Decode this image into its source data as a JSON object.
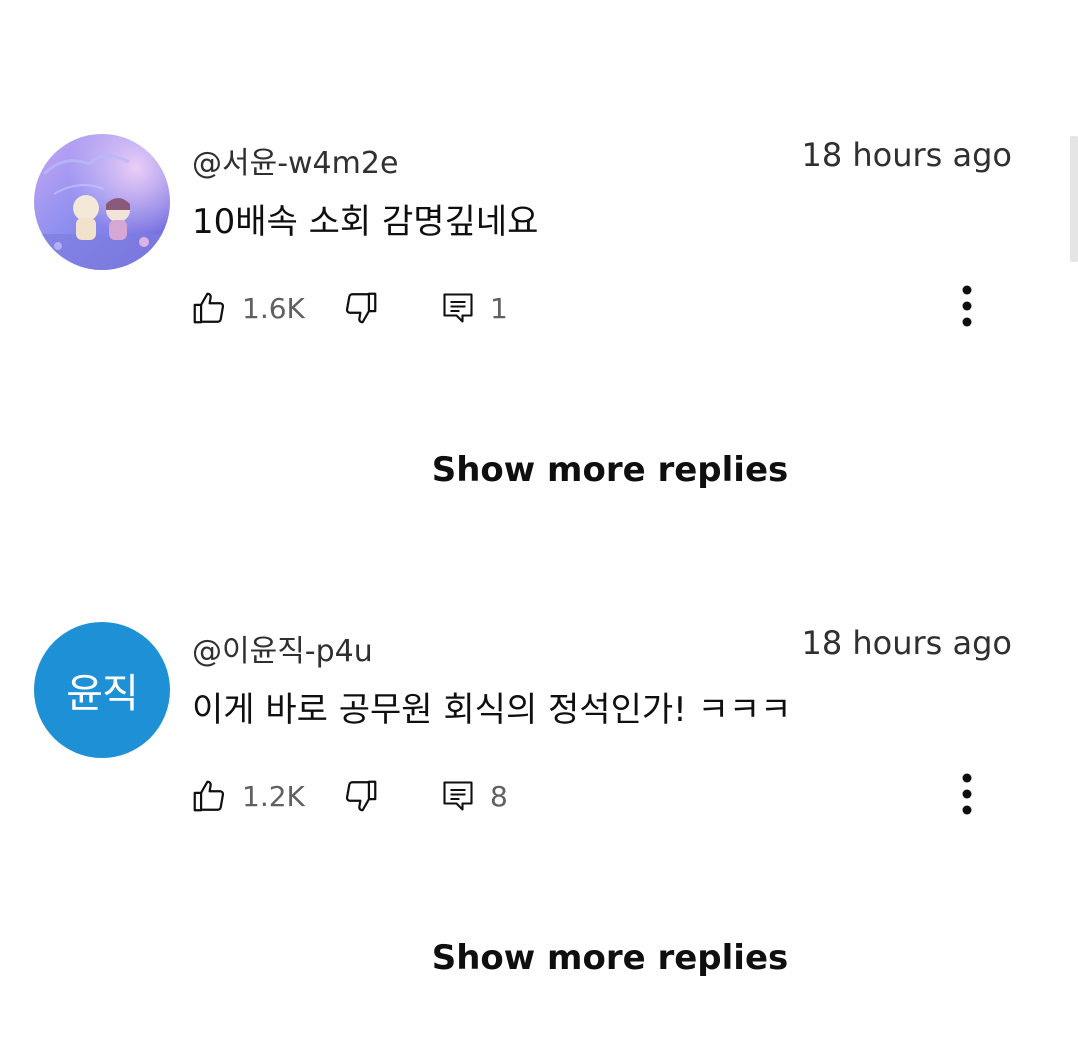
{
  "comments": [
    {
      "author": "@서윤-w4m2e",
      "time": "18 hours ago",
      "text": "10배속 소회 감명깊네요",
      "likes": "1.6K",
      "replies": "1",
      "avatar": {
        "type": "image",
        "description_icon": "illustrated-couple-avatar",
        "colors": [
          "#9aa8f0",
          "#6b5fd6",
          "#e8b6f2"
        ]
      },
      "show_more": "Show more replies"
    },
    {
      "author": "@이윤직-p4u",
      "time": "18 hours ago",
      "text": "이게 바로 공무원 회식의 정석인가! ㅋㅋㅋ",
      "likes": "1.2K",
      "replies": "8",
      "avatar": {
        "type": "initials",
        "initials": "윤직",
        "color": "#1e90d6"
      },
      "show_more": "Show more replies"
    }
  ],
  "icons": {
    "like": "thumbs-up-icon",
    "dislike": "thumbs-down-icon",
    "reply": "comment-icon",
    "more": "more-vertical-icon"
  }
}
